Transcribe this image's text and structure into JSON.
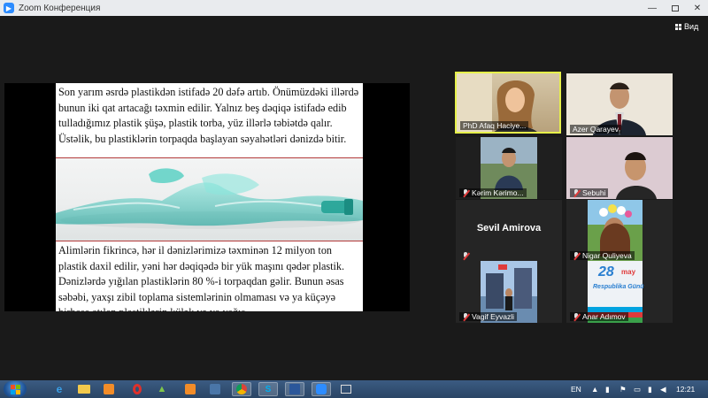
{
  "window": {
    "title": "Zoom Конференция",
    "minimize": "—",
    "close": "✕"
  },
  "toolbar": {
    "view_label": "Вид"
  },
  "slide": {
    "paragraph_top": "Son yarım əsrdə plastikdən istifadə 20 dəfə artıb. Önümüzdəki illərdə bunun iki qat artacağı təxmin edilir. Yalnız beş dəqiqə istifadə edib tulladığımız plastik şüşə, plastik torba, yüz illərlə təbiətdə qalır. Üstəlik, bu plastiklərin torpaqda başlayan səyahətləri dənizdə bitir.",
    "paragraph_bottom": "Alimlərin fikrincə, hər il dənizlərimizə təxminən 12 milyon ton plastik daxil edilir, yəni hər dəqiqədə bir yük maşını qədər plastik. Dənizlərdə yığılan plastiklərin 80 %-i torpaqdan gəlir. Bunun əsas səbəbi, yaxşı zibil toplama sistemlərinin olmaması və ya küçəyə birbaşa atılan plastiklərin külək və ya yağış"
  },
  "participants": [
    {
      "name": "PhD Afaq Haciye...",
      "muted": false,
      "active": true
    },
    {
      "name": "Azer Qarayev",
      "muted": false,
      "active": false
    },
    {
      "name": "Kərim Kərimo...",
      "muted": true,
      "active": false
    },
    {
      "name": "Sebuhi",
      "muted": true,
      "active": false
    },
    {
      "name": "Sevil Amirova",
      "muted": true,
      "active": false,
      "video": false
    },
    {
      "name": "Nigar Quliyeva",
      "muted": true,
      "active": false
    },
    {
      "name": "Vagif Eyvazli",
      "muted": true,
      "active": false
    },
    {
      "name": "Anar Adımov",
      "muted": true,
      "active": false
    }
  ],
  "banner": {
    "day": "28",
    "month": "may",
    "caption": "Respublika Günü"
  },
  "taskbar": {
    "apps": [
      "ie-icon",
      "explorer-icon",
      "media-player-icon",
      "opera-icon",
      "android-icon",
      "odnoklassniki-icon",
      "vk-icon",
      "chrome-icon",
      "skype-icon",
      "word-icon",
      "zoom-icon",
      "window-icon"
    ],
    "language": "EN",
    "clock": "12:21"
  },
  "colors": {
    "active_speaker_border": "#e6f04a",
    "slide_separator": "#b33a3a",
    "taskbar": "#2a4565",
    "mute_slash": "#e03a3a"
  }
}
